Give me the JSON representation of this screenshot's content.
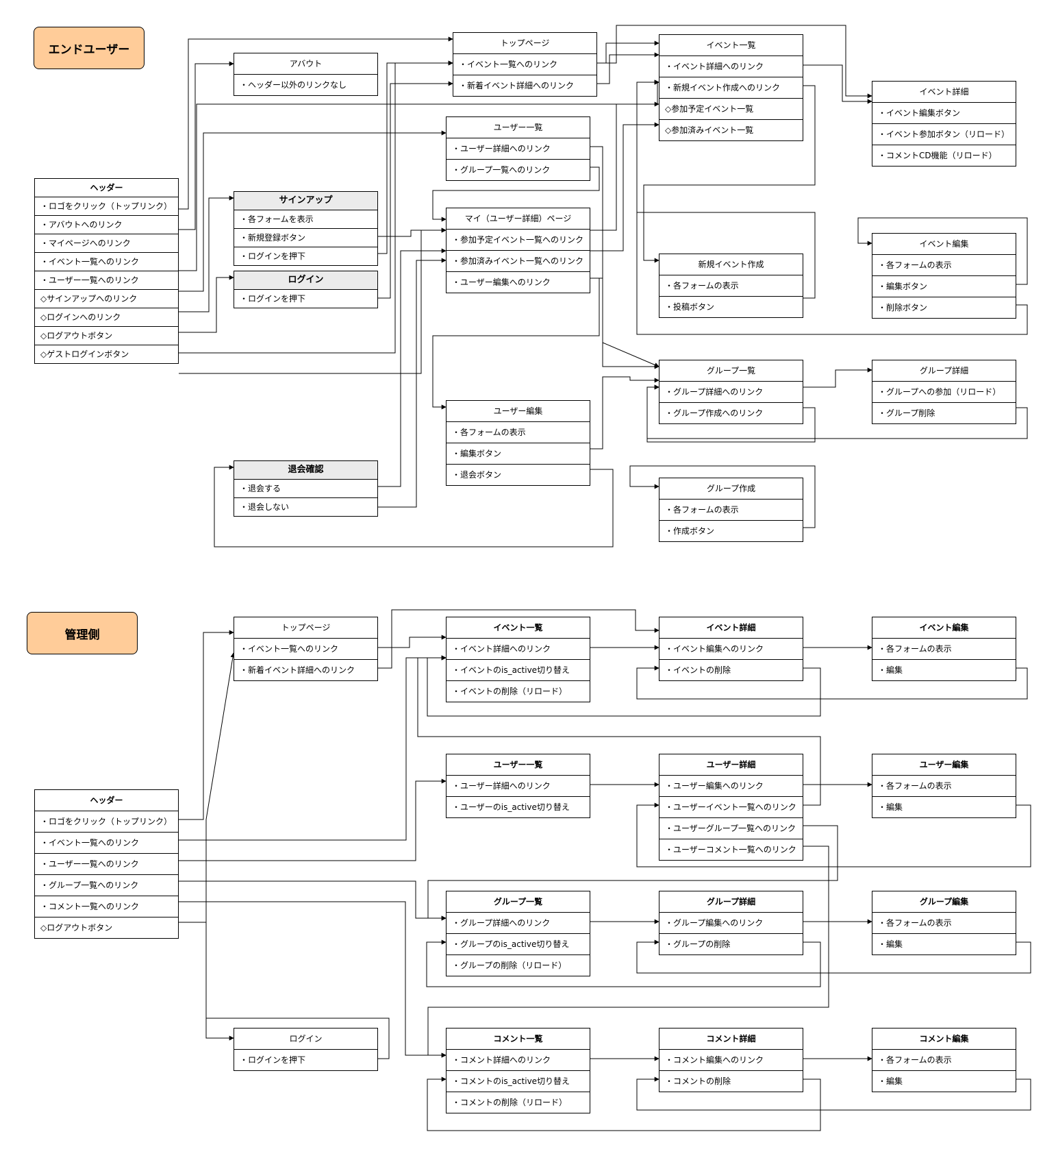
{
  "sections": {
    "enduser_label": "エンドユーザー",
    "admin_label": "管理側"
  },
  "enduser": {
    "header": {
      "title": "ヘッダー",
      "items": [
        "・ロゴをクリック（トップリンク）",
        "・アバウトへのリンク",
        "・マイページへのリンク",
        "・イベント一覧へのリンク",
        "・ユーザー一覧へのリンク",
        "◇サインアップへのリンク",
        "◇ログインへのリンク",
        "◇ログアウトボタン",
        "◇ゲストログインボタン"
      ]
    },
    "about": {
      "title": "アバウト",
      "items": [
        "・ヘッダー以外のリンクなし"
      ]
    },
    "top": {
      "title": "トップページ",
      "items": [
        "・イベント一覧へのリンク",
        "・新着イベント詳細へのリンク"
      ]
    },
    "event_list": {
      "title": "イベント一覧",
      "items": [
        "・イベント詳細へのリンク",
        "・新規イベント作成へのリンク",
        "◇参加予定イベント一覧",
        "◇参加済みイベント一覧"
      ]
    },
    "event_detail": {
      "title": "イベント詳細",
      "items": [
        "・イベント編集ボタン",
        "・イベント参加ボタン（リロード）",
        "・コメントCD機能（リロード）"
      ]
    },
    "user_list": {
      "title": "ユーザー一覧",
      "items": [
        "・ユーザー詳細へのリンク",
        "・グループ一覧へのリンク"
      ]
    },
    "signup": {
      "title": "サインアップ",
      "items": [
        "・各フォームを表示",
        "・新規登録ボタン",
        "・ログインを押下"
      ]
    },
    "login": {
      "title": "ログイン",
      "items": [
        "・ログインを押下"
      ]
    },
    "my_page": {
      "title": "マイ（ユーザー詳細）ページ",
      "items": [
        "・参加予定イベント一覧へのリンク",
        "・参加済みイベント一覧へのリンク",
        "・ユーザー編集へのリンク"
      ]
    },
    "event_new": {
      "title": "新規イベント作成",
      "items": [
        "・各フォームの表示",
        "・投稿ボタン"
      ]
    },
    "event_edit": {
      "title": "イベント編集",
      "items": [
        "・各フォームの表示",
        "・編集ボタン",
        "・削除ボタン"
      ]
    },
    "group_list": {
      "title": "グループ一覧",
      "items": [
        "・グループ詳細へのリンク",
        "・グループ作成へのリンク"
      ]
    },
    "group_detail": {
      "title": "グループ詳細",
      "items": [
        "・グループへの参加（リロード）",
        "・グループ削除"
      ]
    },
    "user_edit": {
      "title": "ユーザー編集",
      "items": [
        "・各フォームの表示",
        "・編集ボタン",
        "・退会ボタン"
      ]
    },
    "withdraw": {
      "title": "退会確認",
      "items": [
        "・退会する",
        "・退会しない"
      ]
    },
    "group_new": {
      "title": "グループ作成",
      "items": [
        "・各フォームの表示",
        "・作成ボタン"
      ]
    }
  },
  "admin": {
    "top": {
      "title": "トップページ",
      "items": [
        "・イベント一覧へのリンク",
        "・新着イベント詳細へのリンク"
      ]
    },
    "event_list": {
      "title": "イベント一覧",
      "items": [
        "・イベント詳細へのリンク",
        "・イベントのis_active切り替え",
        "・イベントの削除（リロード）"
      ]
    },
    "event_detail": {
      "title": "イベント詳細",
      "items": [
        "・イベント編集へのリンク",
        "・イベントの削除"
      ]
    },
    "event_edit": {
      "title": "イベント編集",
      "items": [
        "・各フォームの表示",
        "・編集"
      ]
    },
    "user_list": {
      "title": "ユーザー一覧",
      "items": [
        "・ユーザー詳細へのリンク",
        "・ユーザーのis_active切り替え"
      ]
    },
    "user_detail": {
      "title": "ユーザー詳細",
      "items": [
        "・ユーザー編集へのリンク",
        "・ユーザーイベント一覧へのリンク",
        "・ユーザーグループ一覧へのリンク",
        "・ユーザーコメント一覧へのリンク"
      ]
    },
    "user_edit": {
      "title": "ユーザー編集",
      "items": [
        "・各フォームの表示",
        "・編集"
      ]
    },
    "header": {
      "title": "ヘッダー",
      "items": [
        "・ロゴをクリック（トップリンク）",
        "・イベント一覧へのリンク",
        "・ユーザー一覧へのリンク",
        "・グループ一覧へのリンク",
        "・コメント一覧へのリンク",
        "◇ログアウトボタン"
      ]
    },
    "group_list": {
      "title": "グループ一覧",
      "items": [
        "・グループ詳細へのリンク",
        "・グループのis_active切り替え",
        "・グループの削除（リロード）"
      ]
    },
    "group_detail": {
      "title": "グループ詳細",
      "items": [
        "・グループ編集へのリンク",
        "・グループの削除"
      ]
    },
    "group_edit": {
      "title": "グループ編集",
      "items": [
        "・各フォームの表示",
        "・編集"
      ]
    },
    "login": {
      "title": "ログイン",
      "items": [
        "・ログインを押下"
      ]
    },
    "comment_list": {
      "title": "コメント一覧",
      "items": [
        "・コメント詳細へのリンク",
        "・コメントのis_active切り替え",
        "・コメントの削除（リロード）"
      ]
    },
    "comment_detail": {
      "title": "コメント詳細",
      "items": [
        "・コメント編集へのリンク",
        "・コメントの削除"
      ]
    },
    "comment_edit": {
      "title": "コメント編集",
      "items": [
        "・各フォームの表示",
        "・編集"
      ]
    }
  }
}
